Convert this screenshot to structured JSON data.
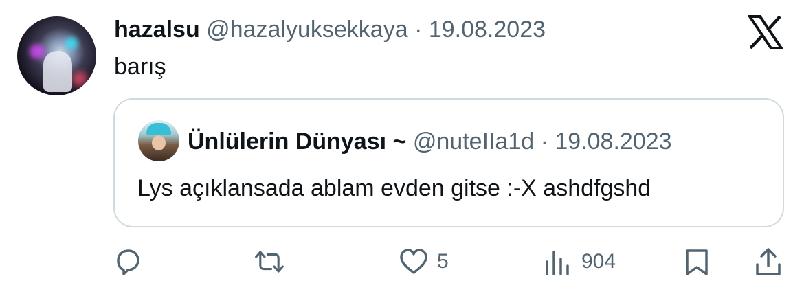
{
  "tweet": {
    "display_name": "hazalsu",
    "handle": "@hazalyuksekkaya",
    "separator": "·",
    "date": "19.08.2023",
    "text": "barış"
  },
  "quoted_tweet": {
    "display_name": "Ünlülerin Dünyası ~",
    "handle": "@nuteIIa1d",
    "separator": "·",
    "date": "19.08.2023",
    "text": "Lys açıklansada ablam evden gitse :-X ashdfgshd"
  },
  "actions": {
    "reply_count": "",
    "retweet_count": "",
    "like_count": "5",
    "view_count": "904"
  },
  "icons": [
    "x-logo-icon",
    "reply-icon",
    "retweet-icon",
    "like-icon",
    "views-icon",
    "bookmark-icon",
    "share-icon"
  ],
  "colors": {
    "text": "#0f1419",
    "muted": "#536471",
    "border": "#cfd9de"
  }
}
